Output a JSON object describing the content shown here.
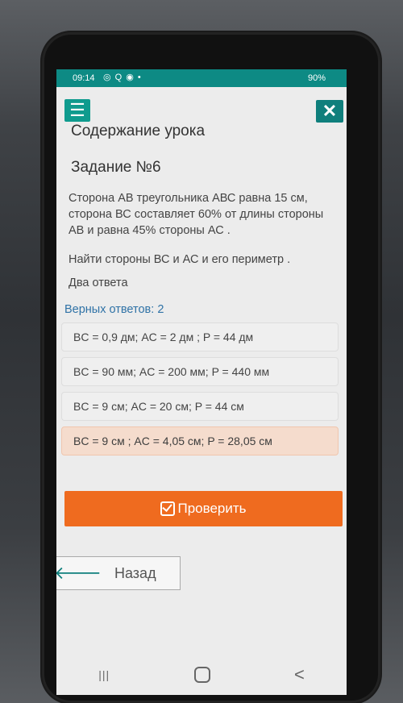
{
  "status": {
    "time": "09:14",
    "icons_left": "◎ Q ◉ •",
    "battery": "90%"
  },
  "header": {
    "menu_icon": "☰",
    "close_icon": "✕",
    "lesson_title": "Содержание урока"
  },
  "task": {
    "title": "Задание №6",
    "text": "Сторона АВ треугольника АВС равна 15 см, сторона ВС составляет 60% от длины стороны АВ и равна 45% стороны АС .",
    "question": "Найти стороны ВС и АС и его периметр .",
    "two_answers": "Два ответа",
    "correct_count": "Верных ответов: 2"
  },
  "options": [
    {
      "label": "BC = 0,9 дм; AC = 2 дм ; P = 44 дм",
      "selected": false
    },
    {
      "label": "BC = 90 мм; AC = 200 мм; P = 440 мм",
      "selected": false
    },
    {
      "label": "BC = 9 см; AC = 20 см; P = 44 см",
      "selected": false
    },
    {
      "label": "BC = 9 см ; AC = 4,05 см; P = 28,05 см",
      "selected": true
    }
  ],
  "buttons": {
    "check_label": "Проверить",
    "back_label": "Назад",
    "back_arrow": "🡐"
  },
  "colors": {
    "teal": "#0f9b8e",
    "orange": "#ef6b1f",
    "selected_bg": "#f5dccd",
    "correct_count_text": "#2f72a6"
  }
}
